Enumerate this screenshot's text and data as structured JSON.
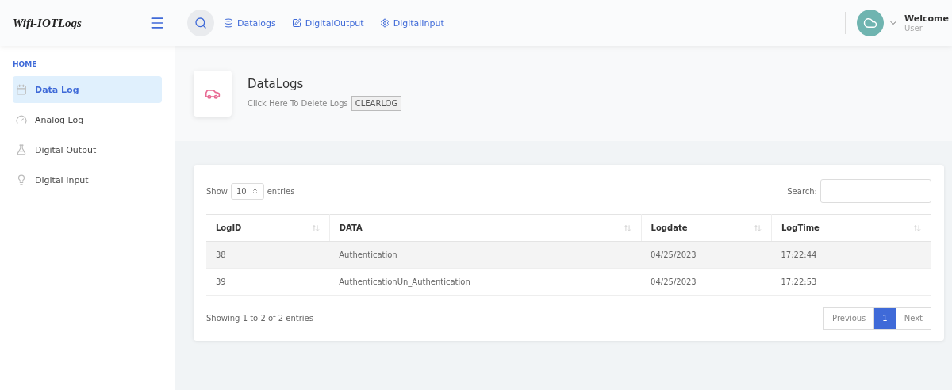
{
  "brand": "Wifi-IOTLogs",
  "topnav": [
    {
      "kind": "database",
      "label": "Datalogs"
    },
    {
      "kind": "edit",
      "label": "DigitalOutput"
    },
    {
      "kind": "gear",
      "label": "DigitalInput"
    }
  ],
  "user": {
    "greeting": "Welcome",
    "name": "User"
  },
  "sidebar": {
    "heading": "HOME",
    "items": [
      {
        "kind": "log",
        "label": "Data Log",
        "selected": true
      },
      {
        "kind": "analog",
        "label": "Analog Log",
        "selected": false
      },
      {
        "kind": "output",
        "label": "Digital Output",
        "selected": false
      },
      {
        "kind": "input",
        "label": "Digital Input",
        "selected": false
      }
    ]
  },
  "page_header": {
    "title": "DataLogs",
    "subtitle": "Click Here To Delete Logs",
    "button": "CLEARLOG"
  },
  "table_controls": {
    "show": "Show",
    "entries_value": "10",
    "entries": "entries",
    "search_label": "Search:"
  },
  "table": {
    "columns": [
      "LogID",
      "DATA",
      "Logdate",
      "LogTime"
    ],
    "rows": [
      [
        "38",
        "Authentication",
        "04/25/2023",
        "17:22:44"
      ],
      [
        "39",
        "AuthenticationUn_Authentication",
        "04/25/2023",
        "17:22:53"
      ]
    ]
  },
  "footer": {
    "info": "Showing 1 to 2 of 2 entries",
    "pagination": [
      {
        "label": "Previous",
        "selected": false
      },
      {
        "label": "1",
        "selected": true
      },
      {
        "label": "Next",
        "selected": false
      }
    ]
  }
}
